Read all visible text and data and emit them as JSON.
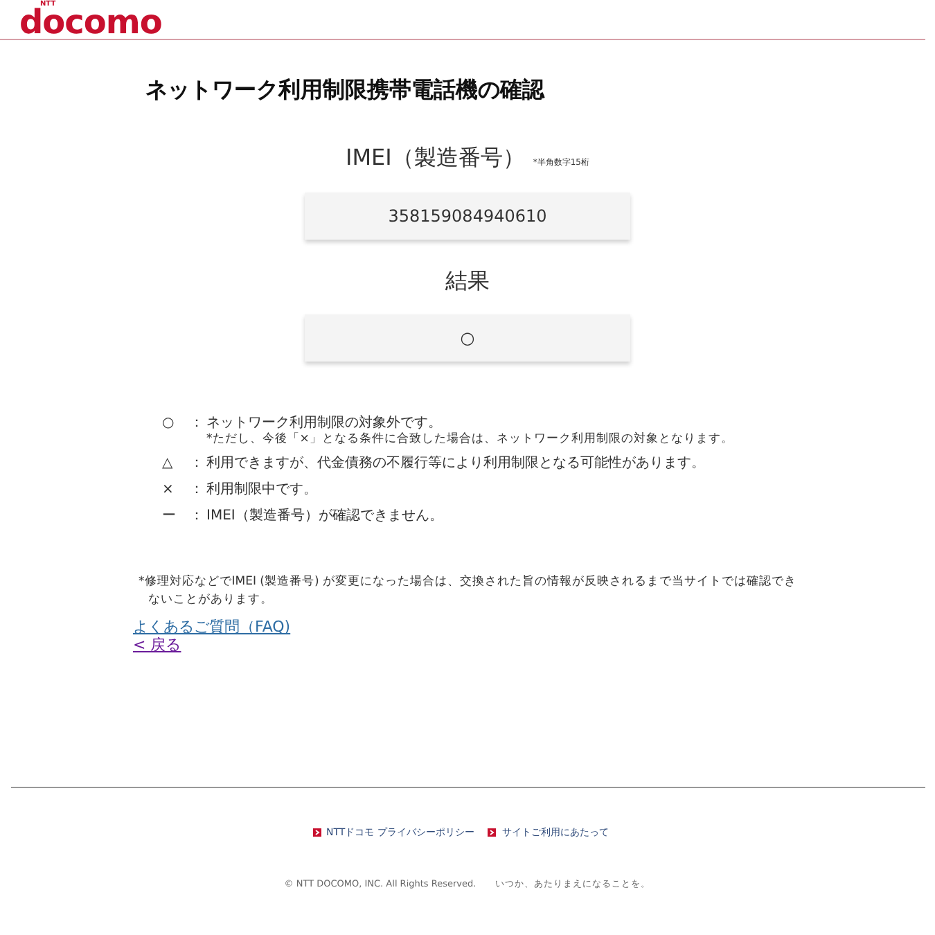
{
  "header": {
    "logo_mark": "NTT",
    "logo": "docomo"
  },
  "title": "ネットワーク利用制限携帯電話機の確認",
  "imei": {
    "label": "IMEI（製造番号）",
    "hint": "*半角数字15桁",
    "value": "358159084940610"
  },
  "result": {
    "label": "結果",
    "value": "○"
  },
  "legend": [
    {
      "symbol": "○",
      "colon": "：",
      "text": "ネットワーク利用制限の対象外です。",
      "note": "*ただし、今後「×」となる条件に合致した場合は、ネットワーク利用制限の対象となります。"
    },
    {
      "symbol": "△",
      "colon": "：",
      "text": "利用できますが、代金債務の不履行等により利用制限となる可能性があります。"
    },
    {
      "symbol": "×",
      "colon": "：",
      "text": "利用制限中です。"
    },
    {
      "symbol": "ー",
      "colon": "：",
      "text": "IMEI（製造番号）が確認できません。"
    }
  ],
  "notice": "*修理対応などでIMEI (製造番号) が変更になった場合は、交換された旨の情報が反映されるまで当サイトでは確認できないことがあります。",
  "links": [
    {
      "text": "よくあるご質問（FAQ)",
      "visited": false
    },
    {
      "text": "< 戻る",
      "visited": true
    }
  ],
  "footer": {
    "links": [
      "NTTドコモ プライバシーポリシー",
      "サイトご利用にあたって"
    ],
    "copyright": "© NTT DOCOMO, INC. All Rights Reserved.",
    "slogan": "いつか、あたりまえになることを。"
  }
}
